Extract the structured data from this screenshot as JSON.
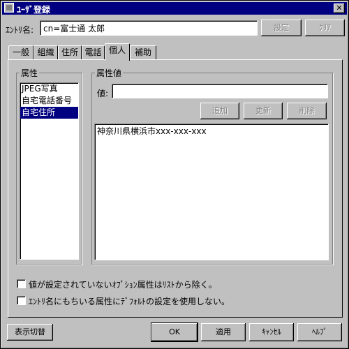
{
  "window": {
    "title": "ﾕｰｻﾞ登録",
    "close_label": "✕"
  },
  "entry": {
    "label": "ｴﾝﾄﾘ名:",
    "value": "cn=富士通 太郎",
    "set_button": "設定",
    "clear_button": "ｸﾘｱ"
  },
  "tabs": [
    "一般",
    "組織",
    "住所",
    "電話",
    "個人",
    "補助"
  ],
  "active_tab": "個人",
  "attributes": {
    "group_label": "属性",
    "items": [
      "JPEG写真",
      "自宅電話番号",
      "自宅住所"
    ],
    "selected": "自宅住所"
  },
  "values": {
    "group_label": "属性値",
    "value_label": "値:",
    "value_input": "",
    "add_button": "追加",
    "update_button": "更新",
    "delete_button": "削除",
    "items": [
      "神奈川県横浜市xxx-xxx-xxx"
    ]
  },
  "options": {
    "exclude_unset": "値が設定されていないｵﾌﾟｼｮﾝ属性はﾘｽﾄから除く。",
    "no_default": "ｴﾝﾄﾘ名にもちいる属性にﾃﾞﾌｫﾙﾄの設定を使用しない。"
  },
  "footer": {
    "toggle_button": "表示切替",
    "ok_button": "OK",
    "apply_button": "適用",
    "cancel_button": "ｷｬﾝｾﾙ",
    "help_button": "ﾍﾙﾌﾟ"
  }
}
